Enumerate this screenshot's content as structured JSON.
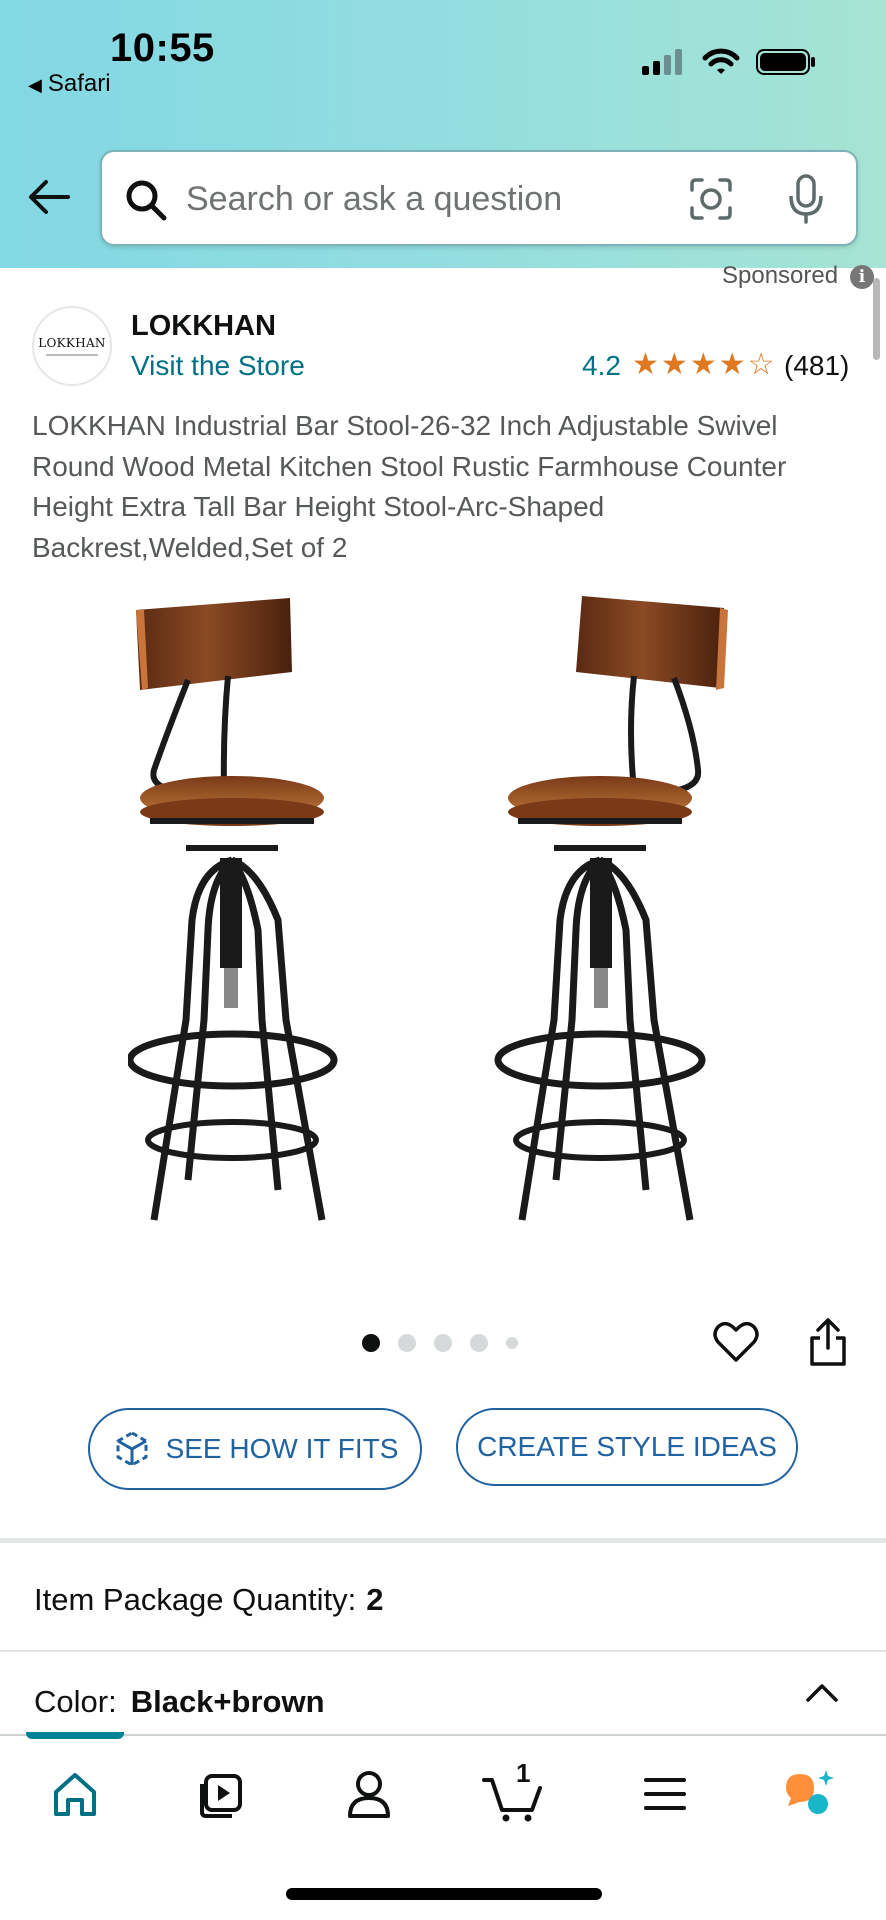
{
  "status_bar": {
    "time": "10:55",
    "back_app": "Safari"
  },
  "search": {
    "placeholder": "Search or ask a question"
  },
  "sponsored_label": "Sponsored",
  "store": {
    "logo_text": "LOKKHAN",
    "brand": "LOKKHAN",
    "visit_label": "Visit the Store",
    "rating": "4.2",
    "rating_value": 4.2,
    "review_count": "(481)"
  },
  "product": {
    "title": "LOKKHAN Industrial Bar Stool-26-32 Inch Adjustable Swivel Round Wood Metal Kitchen Stool Rustic Farmhouse Counter Height Extra Tall Bar Height Stool-Arc-Shaped Backrest,Welded,Set of 2",
    "image_count": 5,
    "active_image": 1
  },
  "actions": {
    "see_fit_label": "SEE HOW IT FITS",
    "style_ideas_label": "CREATE STYLE IDEAS"
  },
  "options": {
    "package_label": "Item Package Quantity:",
    "package_value": "2",
    "color_label": "Color:",
    "color_value": "Black+brown"
  },
  "bottom_nav": {
    "items": [
      "home-icon",
      "video-icon",
      "account-icon",
      "cart-icon",
      "menu-icon",
      "rufus-icon"
    ],
    "active": "home-icon",
    "cart_count": "1"
  },
  "colors": {
    "accent_teal": "#007185",
    "link_blue": "#2162a1",
    "star_orange": "#de7921",
    "header_gradient_start": "#82d8e3",
    "header_gradient_end": "#a6e4d3"
  }
}
